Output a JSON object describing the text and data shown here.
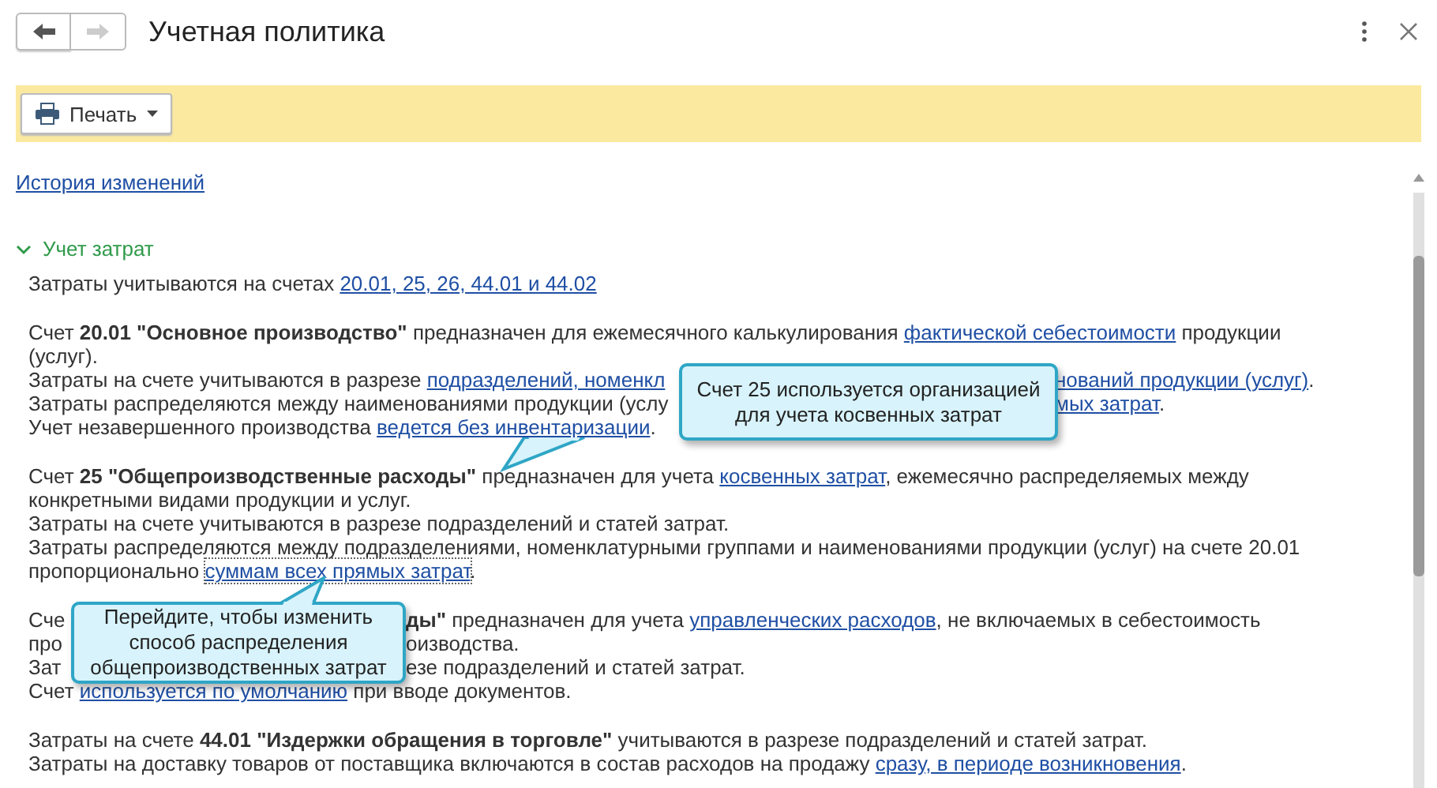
{
  "window": {
    "title": "Учетная политика"
  },
  "toolbar": {
    "print_button": "Печать"
  },
  "history_link": "История изменений",
  "section": {
    "title": "Учет затрат",
    "expanded": true,
    "summary": [
      {
        "kind": "text",
        "t": "Затраты учитываются на счетах "
      },
      {
        "kind": "link",
        "t": "20.01, 25, 26, 44.01 и 44.02"
      }
    ],
    "paragraphs": [
      [
        {
          "parts": [
            {
              "kind": "text",
              "t": "Счет "
            },
            {
              "kind": "bold",
              "t": "20.01 \"Основное производство\""
            },
            {
              "kind": "text",
              "t": " предназначен для ежемесячного калькулирования "
            },
            {
              "kind": "link",
              "t": "фактической себестоимости"
            },
            {
              "kind": "text",
              "t": " продукции"
            }
          ]
        },
        {
          "parts": [
            {
              "kind": "text",
              "t": "(услуг)."
            }
          ]
        },
        {
          "parts": [
            {
              "kind": "text",
              "t": "Затраты на счете учитываются в разрезе "
            },
            {
              "kind": "link",
              "t": "подразделений, номенкл"
            }
          ],
          "resume": [
            {
              "kind": "link",
              "t": "нований продукции (услуг)"
            },
            {
              "kind": "text",
              "t": "."
            }
          ]
        },
        {
          "parts": [
            {
              "kind": "text",
              "t": "Затраты распределяются между наименованиями продукции (услу"
            }
          ],
          "resume": [
            {
              "kind": "link",
              "t": "мых затрат"
            },
            {
              "kind": "text",
              "t": "."
            }
          ]
        },
        {
          "parts": [
            {
              "kind": "text",
              "t": "Учет незавершенного производства "
            },
            {
              "kind": "link",
              "t": "ведется без инвентаризации"
            },
            {
              "kind": "text",
              "t": "."
            }
          ]
        }
      ],
      [
        {
          "parts": [
            {
              "kind": "text",
              "t": "Счет "
            },
            {
              "kind": "bold",
              "t": "25 \"Общепроизводственные расходы\""
            },
            {
              "kind": "text",
              "t": " предназначен для учета "
            },
            {
              "kind": "link",
              "t": "косвенных затрат"
            },
            {
              "kind": "text",
              "t": ", ежемесячно распределяемых между"
            }
          ]
        },
        {
          "parts": [
            {
              "kind": "text",
              "t": "конкретными видами продукции и услуг."
            }
          ]
        },
        {
          "parts": [
            {
              "kind": "text",
              "t": "Затраты на счете учитываются в разрезе подразделений и статей затрат."
            }
          ]
        },
        {
          "parts": [
            {
              "kind": "text",
              "t": "Затраты распределяются между подразделениями, номенклатурными группами и наименованиями продукции (услуг) на счете 20.01"
            }
          ]
        },
        {
          "parts": [
            {
              "kind": "text",
              "t": "пропорционально "
            },
            {
              "kind": "focused-link",
              "t": "суммам всех прямых затрат"
            },
            {
              "kind": "text",
              "t": "."
            }
          ]
        }
      ],
      [
        {
          "parts": [
            {
              "kind": "text",
              "t": "Сче"
            }
          ],
          "resume": [
            {
              "kind": "bold",
              "t": "ды\""
            },
            {
              "kind": "text",
              "t": " предназначен для учета "
            },
            {
              "kind": "link",
              "t": "управленческих расходов"
            },
            {
              "kind": "text",
              "t": ", не включаемых в себестоимость"
            }
          ]
        },
        {
          "parts": [
            {
              "kind": "text",
              "t": "про"
            }
          ],
          "resume": [
            {
              "kind": "text",
              "t": "оизводства."
            }
          ]
        },
        {
          "parts": [
            {
              "kind": "text",
              "t": "Зат"
            }
          ],
          "resume": [
            {
              "kind": "text",
              "t": "езе подразделений и статей затрат."
            }
          ]
        },
        {
          "parts": [
            {
              "kind": "text",
              "t": "Счет "
            },
            {
              "kind": "link",
              "t": "используется по умолчанию"
            },
            {
              "kind": "text",
              "t": " при вводе документов."
            }
          ]
        }
      ],
      [
        {
          "parts": [
            {
              "kind": "text",
              "t": "Затраты на счете "
            },
            {
              "kind": "bold",
              "t": "44.01 \"Издержки обращения в торговле\""
            },
            {
              "kind": "text",
              "t": " учитываются в разрезе подразделений и статей затрат."
            }
          ]
        },
        {
          "parts": [
            {
              "kind": "text",
              "t": "Затраты на доставку товаров от поставщика включаются в состав расходов на продажу "
            },
            {
              "kind": "link",
              "t": "сразу, в периоде возникновения"
            },
            {
              "kind": "text",
              "t": "."
            }
          ]
        }
      ]
    ]
  },
  "callouts": [
    {
      "text": "Счет 25 используется организацией для учета косвенных затрат"
    },
    {
      "text": "Перейдите, чтобы изменить способ распределения общепроизводственных затрат"
    }
  ]
}
